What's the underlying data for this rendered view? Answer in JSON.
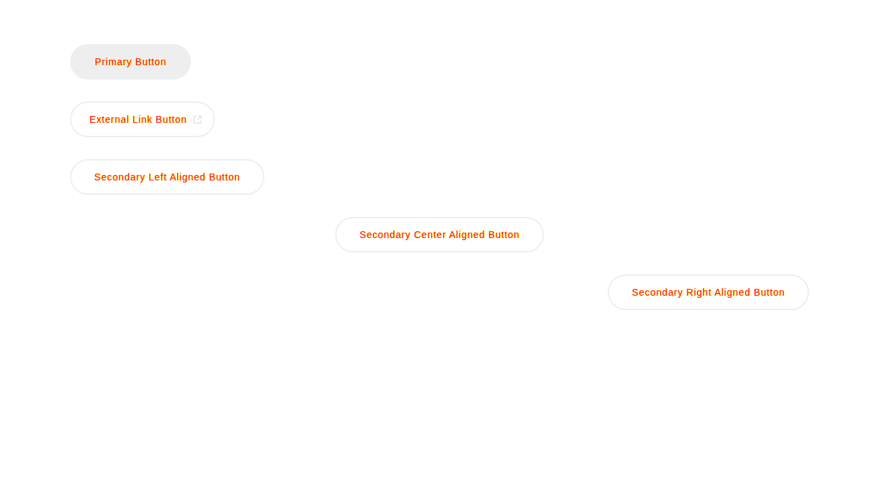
{
  "buttons_left": [
    {
      "kind": "primary",
      "label": "Primary Button"
    },
    {
      "kind": "external",
      "label": "External Link Button"
    },
    {
      "kind": "secondary",
      "label": "Secondary Left Aligned Button"
    }
  ],
  "buttons_center": [
    {
      "kind": "secondary",
      "label": "Secondary Center Aligned Button"
    }
  ],
  "buttons_right": [
    {
      "kind": "secondary",
      "label": "Secondary Right Aligned Button"
    }
  ]
}
